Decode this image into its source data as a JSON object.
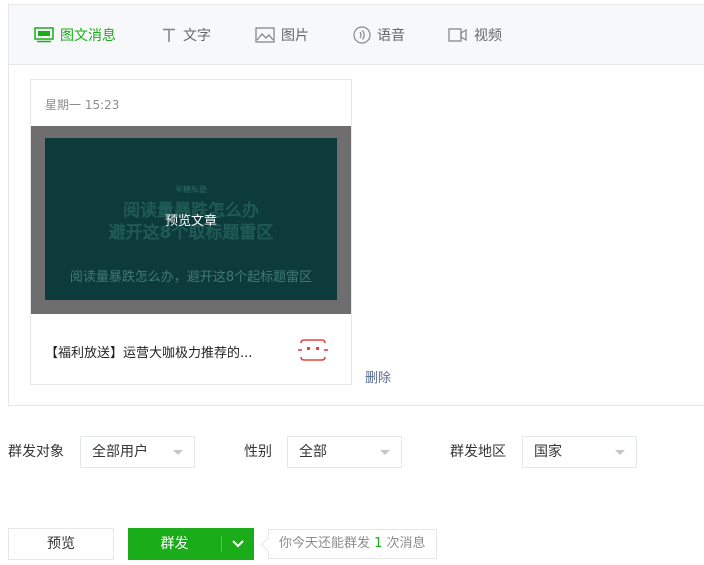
{
  "tabs": [
    {
      "label": "图文消息",
      "icon": "article-icon",
      "active": true
    },
    {
      "label": "文字",
      "icon": "text-icon",
      "active": false
    },
    {
      "label": "图片",
      "icon": "image-icon",
      "active": false
    },
    {
      "label": "语音",
      "icon": "voice-icon",
      "active": false
    },
    {
      "label": "视频",
      "icon": "video-icon",
      "active": false
    }
  ],
  "article": {
    "time": "星期一 15:23",
    "cover_brand": "半糖私塾",
    "cover_headline_line1": "阅读量暴跌怎么办",
    "cover_headline_line2": "避开这8个取标题雷区",
    "cover_subtitle": "阅读量暴跌怎么办，避开这8个起标题雷区",
    "preview_overlay": "预览文章",
    "title": "【福利放送】运营大咖极力推荐的...",
    "delete_label": "删除"
  },
  "filters": {
    "target_label": "群发对象",
    "target_value": "全部用户",
    "gender_label": "性别",
    "gender_value": "全部",
    "region_label": "群发地区",
    "region_value": "国家"
  },
  "actions": {
    "preview_label": "预览",
    "send_label": "群发",
    "tip_prefix": "你今天还能群发 ",
    "tip_count": "1",
    "tip_suffix": " 次消息"
  },
  "colors": {
    "accent": "#1aad19",
    "link": "#576b95",
    "badge": "#e64340"
  }
}
